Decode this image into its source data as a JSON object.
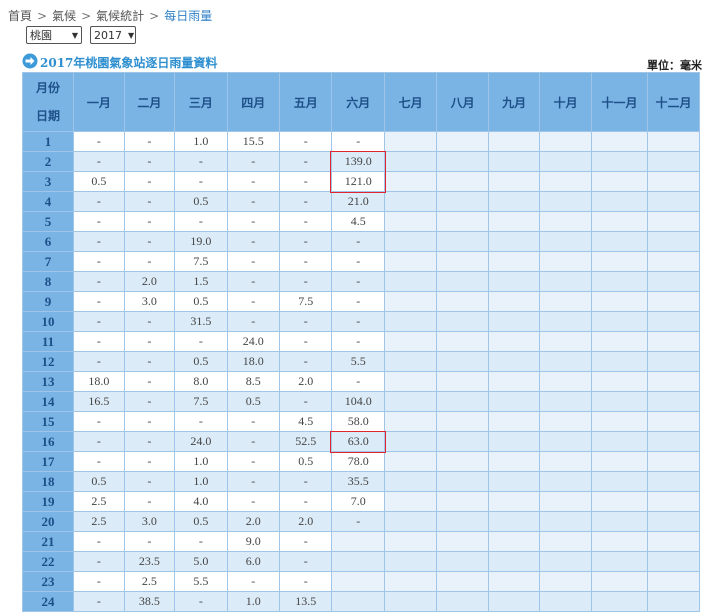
{
  "breadcrumb": {
    "items": [
      "首頁",
      "氣候",
      "氣候統計",
      "每日雨量"
    ],
    "separator": ">"
  },
  "selectors": {
    "station": {
      "value": "桃園",
      "arrow": "▼"
    },
    "year": {
      "value": "2017",
      "arrow": "▼"
    }
  },
  "title": "2017年桃園氣象站逐日雨量資料",
  "unit_label": "單位：毫米",
  "header": {
    "corner_top": "月份",
    "corner_bottom": "日期",
    "months": [
      "一月",
      "二月",
      "三月",
      "四月",
      "五月",
      "六月",
      "七月",
      "八月",
      "九月",
      "十月",
      "十一月",
      "十二月"
    ]
  },
  "rows": [
    {
      "day": "1",
      "values": [
        "-",
        "-",
        "1.0",
        "15.5",
        "-",
        "-",
        "",
        "",
        "",
        "",
        "",
        ""
      ]
    },
    {
      "day": "2",
      "values": [
        "-",
        "-",
        "-",
        "-",
        "-",
        "139.0",
        "",
        "",
        "",
        "",
        "",
        ""
      ]
    },
    {
      "day": "3",
      "values": [
        "0.5",
        "-",
        "-",
        "-",
        "-",
        "121.0",
        "",
        "",
        "",
        "",
        "",
        ""
      ]
    },
    {
      "day": "4",
      "values": [
        "-",
        "-",
        "0.5",
        "-",
        "-",
        "21.0",
        "",
        "",
        "",
        "",
        "",
        ""
      ]
    },
    {
      "day": "5",
      "values": [
        "-",
        "-",
        "-",
        "-",
        "-",
        "4.5",
        "",
        "",
        "",
        "",
        "",
        ""
      ]
    },
    {
      "day": "6",
      "values": [
        "-",
        "-",
        "19.0",
        "-",
        "-",
        "-",
        "",
        "",
        "",
        "",
        "",
        ""
      ]
    },
    {
      "day": "7",
      "values": [
        "-",
        "-",
        "7.5",
        "-",
        "-",
        "-",
        "",
        "",
        "",
        "",
        "",
        ""
      ]
    },
    {
      "day": "8",
      "values": [
        "-",
        "2.0",
        "1.5",
        "-",
        "-",
        "-",
        "",
        "",
        "",
        "",
        "",
        ""
      ]
    },
    {
      "day": "9",
      "values": [
        "-",
        "3.0",
        "0.5",
        "-",
        "7.5",
        "-",
        "",
        "",
        "",
        "",
        "",
        ""
      ]
    },
    {
      "day": "10",
      "values": [
        "-",
        "-",
        "31.5",
        "-",
        "-",
        "-",
        "",
        "",
        "",
        "",
        "",
        ""
      ]
    },
    {
      "day": "11",
      "values": [
        "-",
        "-",
        "-",
        "24.0",
        "-",
        "-",
        "",
        "",
        "",
        "",
        "",
        ""
      ]
    },
    {
      "day": "12",
      "values": [
        "-",
        "-",
        "0.5",
        "18.0",
        "-",
        "5.5",
        "",
        "",
        "",
        "",
        "",
        ""
      ]
    },
    {
      "day": "13",
      "values": [
        "18.0",
        "-",
        "8.0",
        "8.5",
        "2.0",
        "-",
        "",
        "",
        "",
        "",
        "",
        ""
      ]
    },
    {
      "day": "14",
      "values": [
        "16.5",
        "-",
        "7.5",
        "0.5",
        "-",
        "104.0",
        "",
        "",
        "",
        "",
        "",
        ""
      ]
    },
    {
      "day": "15",
      "values": [
        "-",
        "-",
        "-",
        "-",
        "4.5",
        "58.0",
        "",
        "",
        "",
        "",
        "",
        ""
      ]
    },
    {
      "day": "16",
      "values": [
        "-",
        "-",
        "24.0",
        "-",
        "52.5",
        "63.0",
        "",
        "",
        "",
        "",
        "",
        ""
      ]
    },
    {
      "day": "17",
      "values": [
        "-",
        "-",
        "1.0",
        "-",
        "0.5",
        "78.0",
        "",
        "",
        "",
        "",
        "",
        ""
      ]
    },
    {
      "day": "18",
      "values": [
        "0.5",
        "-",
        "1.0",
        "-",
        "-",
        "35.5",
        "",
        "",
        "",
        "",
        "",
        ""
      ]
    },
    {
      "day": "19",
      "values": [
        "2.5",
        "-",
        "4.0",
        "-",
        "-",
        "7.0",
        "",
        "",
        "",
        "",
        "",
        ""
      ]
    },
    {
      "day": "20",
      "values": [
        "2.5",
        "3.0",
        "0.5",
        "2.0",
        "2.0",
        "-",
        "",
        "",
        "",
        "",
        "",
        ""
      ]
    },
    {
      "day": "21",
      "values": [
        "-",
        "-",
        "-",
        "9.0",
        "-",
        "",
        "",
        "",
        "",
        "",
        "",
        ""
      ]
    },
    {
      "day": "22",
      "values": [
        "-",
        "23.5",
        "5.0",
        "6.0",
        "-",
        "",
        "",
        "",
        "",
        "",
        "",
        ""
      ]
    },
    {
      "day": "23",
      "values": [
        "-",
        "2.5",
        "5.5",
        "-",
        "-",
        "",
        "",
        "",
        "",
        "",
        "",
        ""
      ]
    },
    {
      "day": "24",
      "values": [
        "-",
        "38.5",
        "-",
        "1.0",
        "13.5",
        "",
        "",
        "",
        "",
        "",
        "",
        ""
      ]
    }
  ],
  "highlights": [
    {
      "day_from": "2",
      "day_to": "3",
      "month": "六月"
    },
    {
      "day_from": "16",
      "day_to": "16",
      "month": "六月"
    }
  ],
  "colors": {
    "header_bg": "#7ab4e4",
    "header_text": "#1d4f88",
    "title": "#2e8fd0",
    "highlight_border": "#e0252d"
  }
}
